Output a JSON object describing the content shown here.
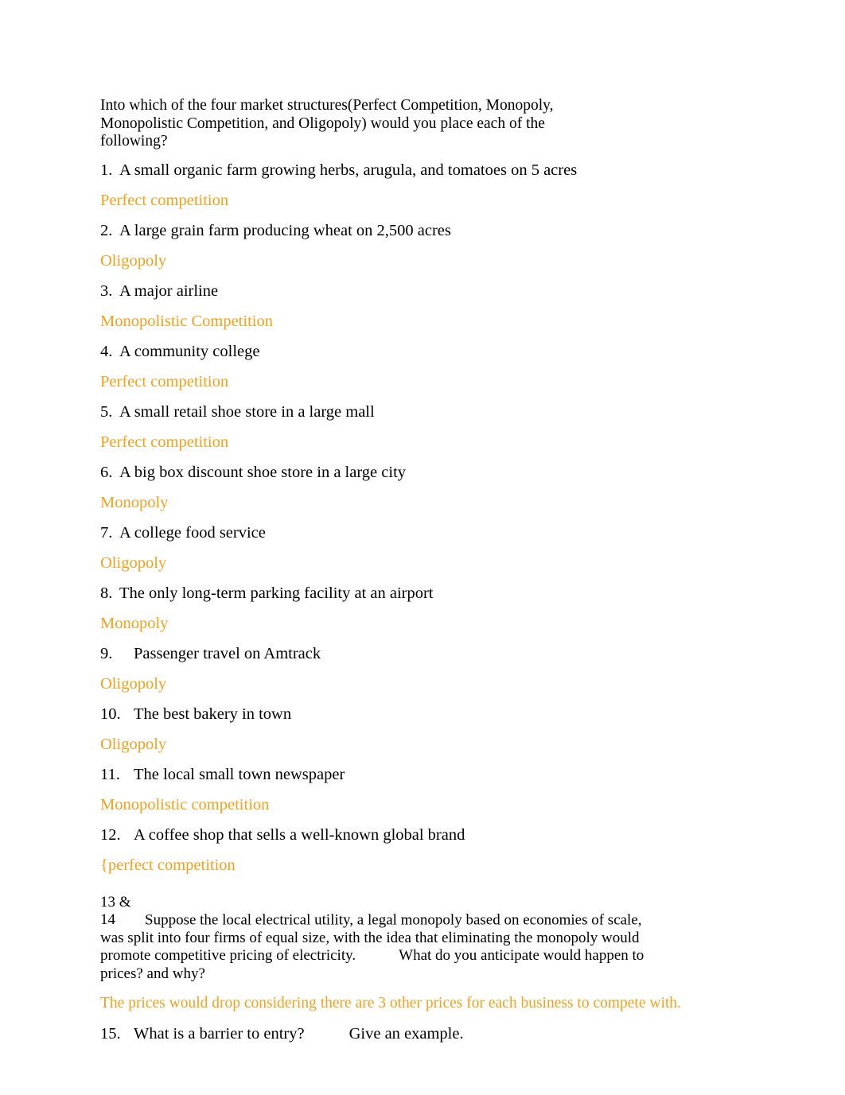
{
  "document": {
    "intro": "Into which of the four market structures(Perfect Competition, Monopoly, Monopolistic Competition, and Oligopoly) would you place each of the following?",
    "items": [
      {
        "number": "1.",
        "text": "A small organic farm growing herbs, arugula, and tomatoes on 5 acres",
        "answer": "Perfect competition"
      },
      {
        "number": "2.",
        "text": "A large grain farm producing wheat on 2,500 acres",
        "answer": "Oligopoly"
      },
      {
        "number": "3.",
        "text": "A major airline",
        "answer": "Monopolistic Competition"
      },
      {
        "number": "4.",
        "text": "A community college",
        "answer": "Perfect competition"
      },
      {
        "number": "5.",
        "text": "A small retail shoe store in a large mall",
        "answer": "Perfect competition"
      },
      {
        "number": "6.",
        "text": "A big box discount shoe store in a large city",
        "answer": "Monopoly"
      },
      {
        "number": "7.",
        "text": "A college food service",
        "answer": "Oligopoly"
      },
      {
        "number": "8.",
        "text": "The only long-term parking facility at an airport",
        "answer": "Monopoly"
      },
      {
        "number": "9.",
        "text": "Passenger travel on Amtrack",
        "answer": "Oligopoly"
      },
      {
        "number": "10.",
        "text": "The best bakery in town",
        "answer": "Oligopoly"
      },
      {
        "number": "11.",
        "text": "The local small town newspaper",
        "answer": "Monopolistic competition"
      },
      {
        "number": "12.",
        "text": "A coffee shop that sells a well-known global brand",
        "answer": "{perfect competition"
      }
    ],
    "question_block": {
      "number": "13 & 14",
      "text_part1": "Suppose the local electrical utility, a legal monopoly based on economies of scale, was split into four firms of equal size, with the idea that eliminating the monopoly would promote competitive pricing of electricity.",
      "text_part2": "What do you anticipate would happen to prices? and why?",
      "answer": "The prices would drop considering there are 3 other prices for each business to compete with."
    },
    "final_item": {
      "number": "15.",
      "text_part1": "What is a barrier to entry?",
      "text_part2": "Give an example."
    },
    "colors": {
      "answer_orange": "#f2a11e",
      "body_text": "#000000",
      "page_background": "#ffffff"
    }
  }
}
